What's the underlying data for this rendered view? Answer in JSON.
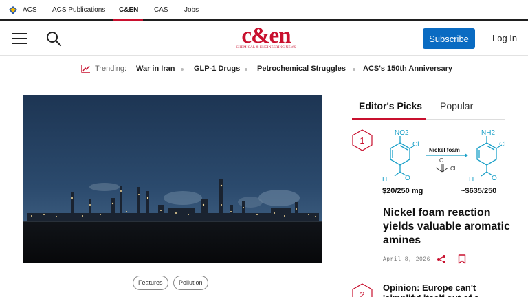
{
  "acs_bar": {
    "links": [
      "ACS",
      "ACS Publications",
      "C&EN",
      "CAS",
      "Jobs"
    ],
    "active": "C&EN"
  },
  "header": {
    "logo_text": "c&en",
    "logo_subtitle": "CHEMICAL & ENGINEERING NEWS",
    "subscribe_label": "Subscribe",
    "login_label": "Log In"
  },
  "trending": {
    "label": "Trending:",
    "items": [
      "War in Iran",
      "GLP-1 Drugs",
      "Petrochemical Struggles",
      "ACS's 150th Anniversary"
    ]
  },
  "hero": {
    "tags": [
      "Features",
      "Pollution"
    ]
  },
  "sidebar": {
    "tabs": [
      "Editor's Picks",
      "Popular"
    ],
    "active_tab": "Editor's Picks",
    "articles": [
      {
        "rank": "1",
        "title": "Nickel foam reaction yields valuable aromatic amines",
        "date": "April 8, 2026",
        "diagram": {
          "reagent": "Nickel foam",
          "left_price": "$20/250 mg",
          "right_price": "~$635/250",
          "left_group": "NO2",
          "right_group": "NH2",
          "halogen": "Cl",
          "aldehyde_o": "O",
          "aldehyde_h": "H"
        }
      },
      {
        "rank": "2",
        "title": "Opinion: Europe can't 'simplify' itself out of a"
      }
    ]
  },
  "colors": {
    "brand_red": "#c8102e",
    "subscribe_blue": "#0a6bc2",
    "molecule_teal": "#1aa0c8"
  }
}
